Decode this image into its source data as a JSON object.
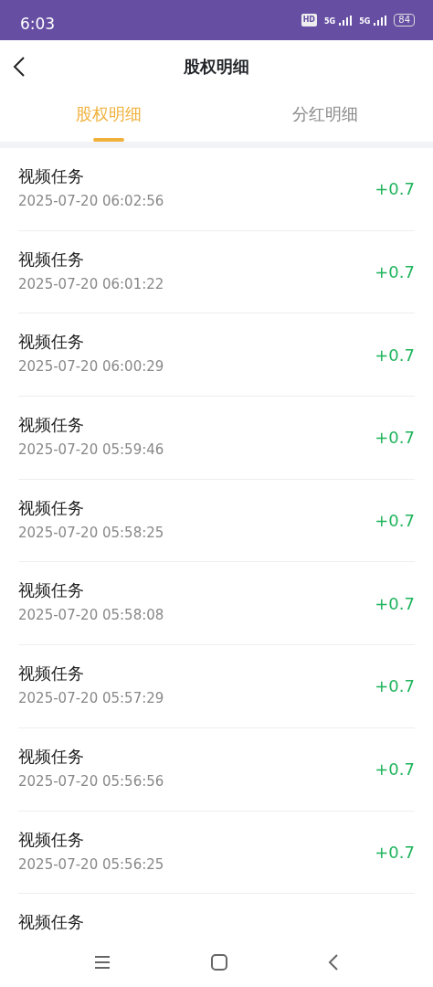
{
  "status_bar": {
    "time": "6:03",
    "hd_badge": "HD",
    "networks": [
      "5G",
      "5G"
    ],
    "battery": "84"
  },
  "header": {
    "title": "股权明细"
  },
  "tabs": [
    {
      "label": "股权明细",
      "selected": true
    },
    {
      "label": "分红明细",
      "selected": false
    }
  ],
  "records": [
    {
      "title": "视频任务",
      "time": "2025-07-20 06:02:56",
      "amount": "+0.7"
    },
    {
      "title": "视频任务",
      "time": "2025-07-20 06:01:22",
      "amount": "+0.7"
    },
    {
      "title": "视频任务",
      "time": "2025-07-20 06:00:29",
      "amount": "+0.7"
    },
    {
      "title": "视频任务",
      "time": "2025-07-20 05:59:46",
      "amount": "+0.7"
    },
    {
      "title": "视频任务",
      "time": "2025-07-20 05:58:25",
      "amount": "+0.7"
    },
    {
      "title": "视频任务",
      "time": "2025-07-20 05:58:08",
      "amount": "+0.7"
    },
    {
      "title": "视频任务",
      "time": "2025-07-20 05:57:29",
      "amount": "+0.7"
    },
    {
      "title": "视频任务",
      "time": "2025-07-20 05:56:56",
      "amount": "+0.7"
    },
    {
      "title": "视频任务",
      "time": "2025-07-20 05:56:25",
      "amount": "+0.7"
    },
    {
      "title": "视频任务"
    }
  ]
}
